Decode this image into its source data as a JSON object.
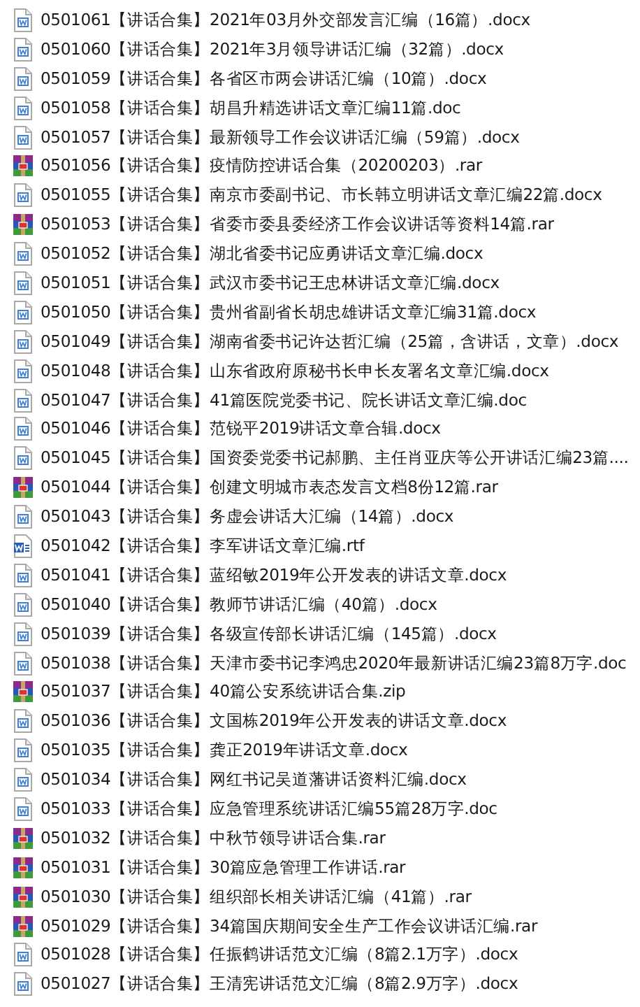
{
  "files": [
    {
      "kind": "word",
      "name": "0501061【讲话合集】2021年03月外交部发言汇编（16篇）.docx"
    },
    {
      "kind": "word",
      "name": "0501060【讲话合集】2021年3月领导讲话汇编（32篇）.docx"
    },
    {
      "kind": "word",
      "name": "0501059【讲话合集】各省区市两会讲话汇编（10篇）.docx"
    },
    {
      "kind": "word",
      "name": "0501058【讲话合集】胡昌升精选讲话文章汇编11篇.doc"
    },
    {
      "kind": "word",
      "name": "0501057【讲话合集】最新领导工作会议讲话汇编（59篇）.docx"
    },
    {
      "kind": "archive",
      "name": "0501056【讲话合集】疫情防控讲话合集（20200203）.rar"
    },
    {
      "kind": "word",
      "name": "0501055【讲话合集】南京市委副书记、市长韩立明讲话文章汇编22篇.docx"
    },
    {
      "kind": "archive",
      "name": "0501053【讲话合集】省委市委县委经济工作会议讲话等资料14篇.rar"
    },
    {
      "kind": "word",
      "name": "0501052【讲话合集】湖北省委书记应勇讲话文章汇编.docx"
    },
    {
      "kind": "word",
      "name": "0501051【讲话合集】武汉市委书记王忠林讲话文章汇编.docx"
    },
    {
      "kind": "word",
      "name": "0501050【讲话合集】贵州省副省长胡忠雄讲话文章汇编31篇.docx"
    },
    {
      "kind": "word",
      "name": "0501049【讲话合集】湖南省委书记许达哲汇编（25篇，含讲话，文章）.docx"
    },
    {
      "kind": "word",
      "name": "0501048【讲话合集】山东省政府原秘书长申长友署名文章汇编.docx"
    },
    {
      "kind": "word",
      "name": "0501047【讲话合集】41篇医院党委书记、院长讲话文章汇编.doc"
    },
    {
      "kind": "word",
      "name": "0501046【讲话合集】范锐平2019讲话文章合辑.docx"
    },
    {
      "kind": "word",
      "name": "0501045【讲话合集】国资委党委书记郝鹏、主任肖亚庆等公开讲话汇编23篇...."
    },
    {
      "kind": "archive",
      "name": "0501044【讲话合集】创建文明城市表态发言文档8份12篇.rar"
    },
    {
      "kind": "word",
      "name": "0501043【讲话合集】务虚会讲话大汇编（14篇）.docx"
    },
    {
      "kind": "rtf",
      "name": "0501042【讲话合集】李军讲话文章汇编.rtf"
    },
    {
      "kind": "word",
      "name": "0501041【讲话合集】蓝绍敏2019年公开发表的讲话文章.docx"
    },
    {
      "kind": "word",
      "name": "0501040【讲话合集】教师节讲话汇编（40篇）.docx"
    },
    {
      "kind": "word",
      "name": "0501039【讲话合集】各级宣传部长讲话汇编（145篇）.docx"
    },
    {
      "kind": "word",
      "name": "0501038【讲话合集】天津市委书记李鸿忠2020年最新讲话汇编23篇8万字.doc"
    },
    {
      "kind": "archive",
      "name": "0501037【讲话合集】40篇公安系统讲话合集.zip"
    },
    {
      "kind": "word",
      "name": "0501036【讲话合集】文国栋2019年公开发表的讲话文章.docx"
    },
    {
      "kind": "word",
      "name": "0501035【讲话合集】龚正2019年讲话文章.docx"
    },
    {
      "kind": "word",
      "name": "0501034【讲话合集】网红书记吴道藩讲话资料汇编.docx"
    },
    {
      "kind": "word",
      "name": "0501033【讲话合集】应急管理系统讲话汇编55篇28万字.doc"
    },
    {
      "kind": "archive",
      "name": "0501032【讲话合集】中秋节领导讲话合集.rar"
    },
    {
      "kind": "archive",
      "name": "0501031【讲话合集】30篇应急管理工作讲话.rar"
    },
    {
      "kind": "archive",
      "name": "0501030【讲话合集】组织部长相关讲话汇编（41篇）.rar"
    },
    {
      "kind": "archive",
      "name": "0501029【讲话合集】34篇国庆期间安全生产工作会议讲话汇编.rar"
    },
    {
      "kind": "word",
      "name": "0501028【讲话合集】任振鹤讲话范文汇编（8篇2.1万字）.docx"
    },
    {
      "kind": "word",
      "name": "0501027【讲话合集】王清宪讲话范文汇编（8篇2.9万字）.docx"
    }
  ]
}
